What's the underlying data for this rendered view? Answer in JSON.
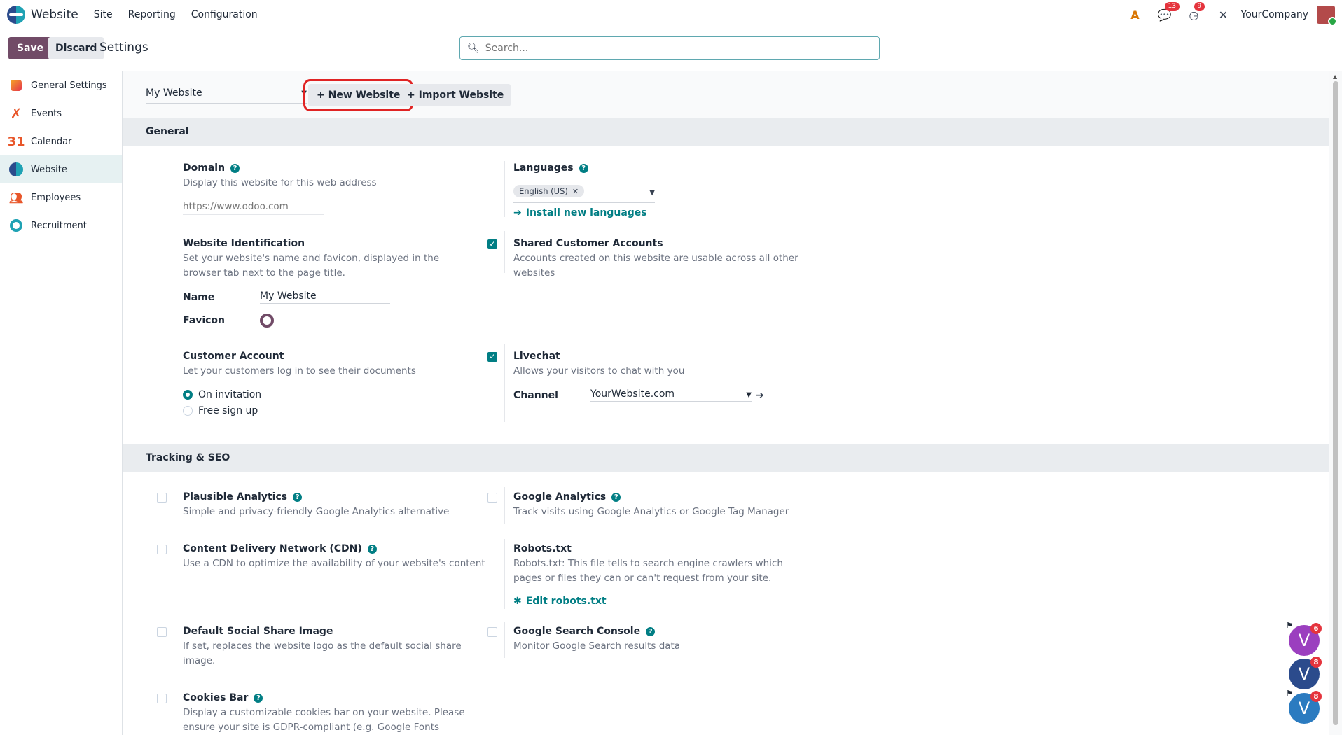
{
  "navbar": {
    "app_name": "Website",
    "menus": [
      "Site",
      "Reporting",
      "Configuration"
    ],
    "chat_badge": "13",
    "activity_badge": "9",
    "company": "YourCompany"
  },
  "control": {
    "save_label": "Save",
    "discard_label": "Discard",
    "title": "Settings",
    "search_placeholder": "Search..."
  },
  "sidebar": {
    "items": [
      {
        "label": "General Settings",
        "icon": "general-settings-icon"
      },
      {
        "label": "Events",
        "icon": "events-icon"
      },
      {
        "label": "Calendar",
        "icon": "calendar-icon"
      },
      {
        "label": "Website",
        "icon": "website-icon"
      },
      {
        "label": "Employees",
        "icon": "employees-icon"
      },
      {
        "label": "Recruitment",
        "icon": "recruitment-icon"
      }
    ]
  },
  "website_bar": {
    "selected_website": "My Website",
    "new_label": "+ New Website",
    "import_label": "+ Import Website"
  },
  "general": {
    "heading": "General",
    "domain": {
      "title": "Domain",
      "desc": "Display this website for this web address",
      "placeholder": "https://www.odoo.com"
    },
    "languages": {
      "title": "Languages",
      "tag": "English (US)",
      "link": "Install new languages"
    },
    "identification": {
      "title": "Website Identification",
      "desc": "Set your website's name and favicon, displayed in the browser tab next to the page title.",
      "name_label": "Name",
      "name_value": "My Website",
      "favicon_label": "Favicon"
    },
    "shared_accounts": {
      "title": "Shared Customer Accounts",
      "desc": "Accounts created on this website are usable across all other websites"
    },
    "customer_account": {
      "title": "Customer Account",
      "desc": "Let your customers log in to see their documents",
      "options": [
        "On invitation",
        "Free sign up"
      ]
    },
    "livechat": {
      "title": "Livechat",
      "desc": "Allows your visitors to chat with you",
      "channel_label": "Channel",
      "channel_value": "YourWebsite.com"
    }
  },
  "tracking": {
    "heading": "Tracking & SEO",
    "plausible": {
      "title": "Plausible Analytics",
      "desc": "Simple and privacy-friendly Google Analytics alternative"
    },
    "google_analytics": {
      "title": "Google Analytics",
      "desc": "Track visits using Google Analytics or Google Tag Manager"
    },
    "cdn": {
      "title": "Content Delivery Network (CDN)",
      "desc": "Use a CDN to optimize the availability of your website's content"
    },
    "robots": {
      "title": "Robots.txt",
      "desc": "Robots.txt: This file tells to search engine crawlers which pages or files they can or can't request from your site.",
      "link": "Edit robots.txt"
    },
    "social_image": {
      "title": "Default Social Share Image",
      "desc": "If set, replaces the website logo as the default social share image."
    },
    "search_console": {
      "title": "Google Search Console",
      "desc": "Monitor Google Search results data"
    },
    "cookies": {
      "title": "Cookies Bar",
      "desc": "Display a customizable cookies bar on your website. Please ensure your site is GDPR-compliant (e.g. Google Fonts usage)."
    }
  },
  "bubbles": [
    {
      "letter": "V",
      "badge": "6",
      "color": "#9b3fbf"
    },
    {
      "letter": "V",
      "badge": "8",
      "color": "#2b4b8c"
    },
    {
      "letter": "V",
      "badge": "8",
      "color": "#2b7bc0"
    }
  ]
}
